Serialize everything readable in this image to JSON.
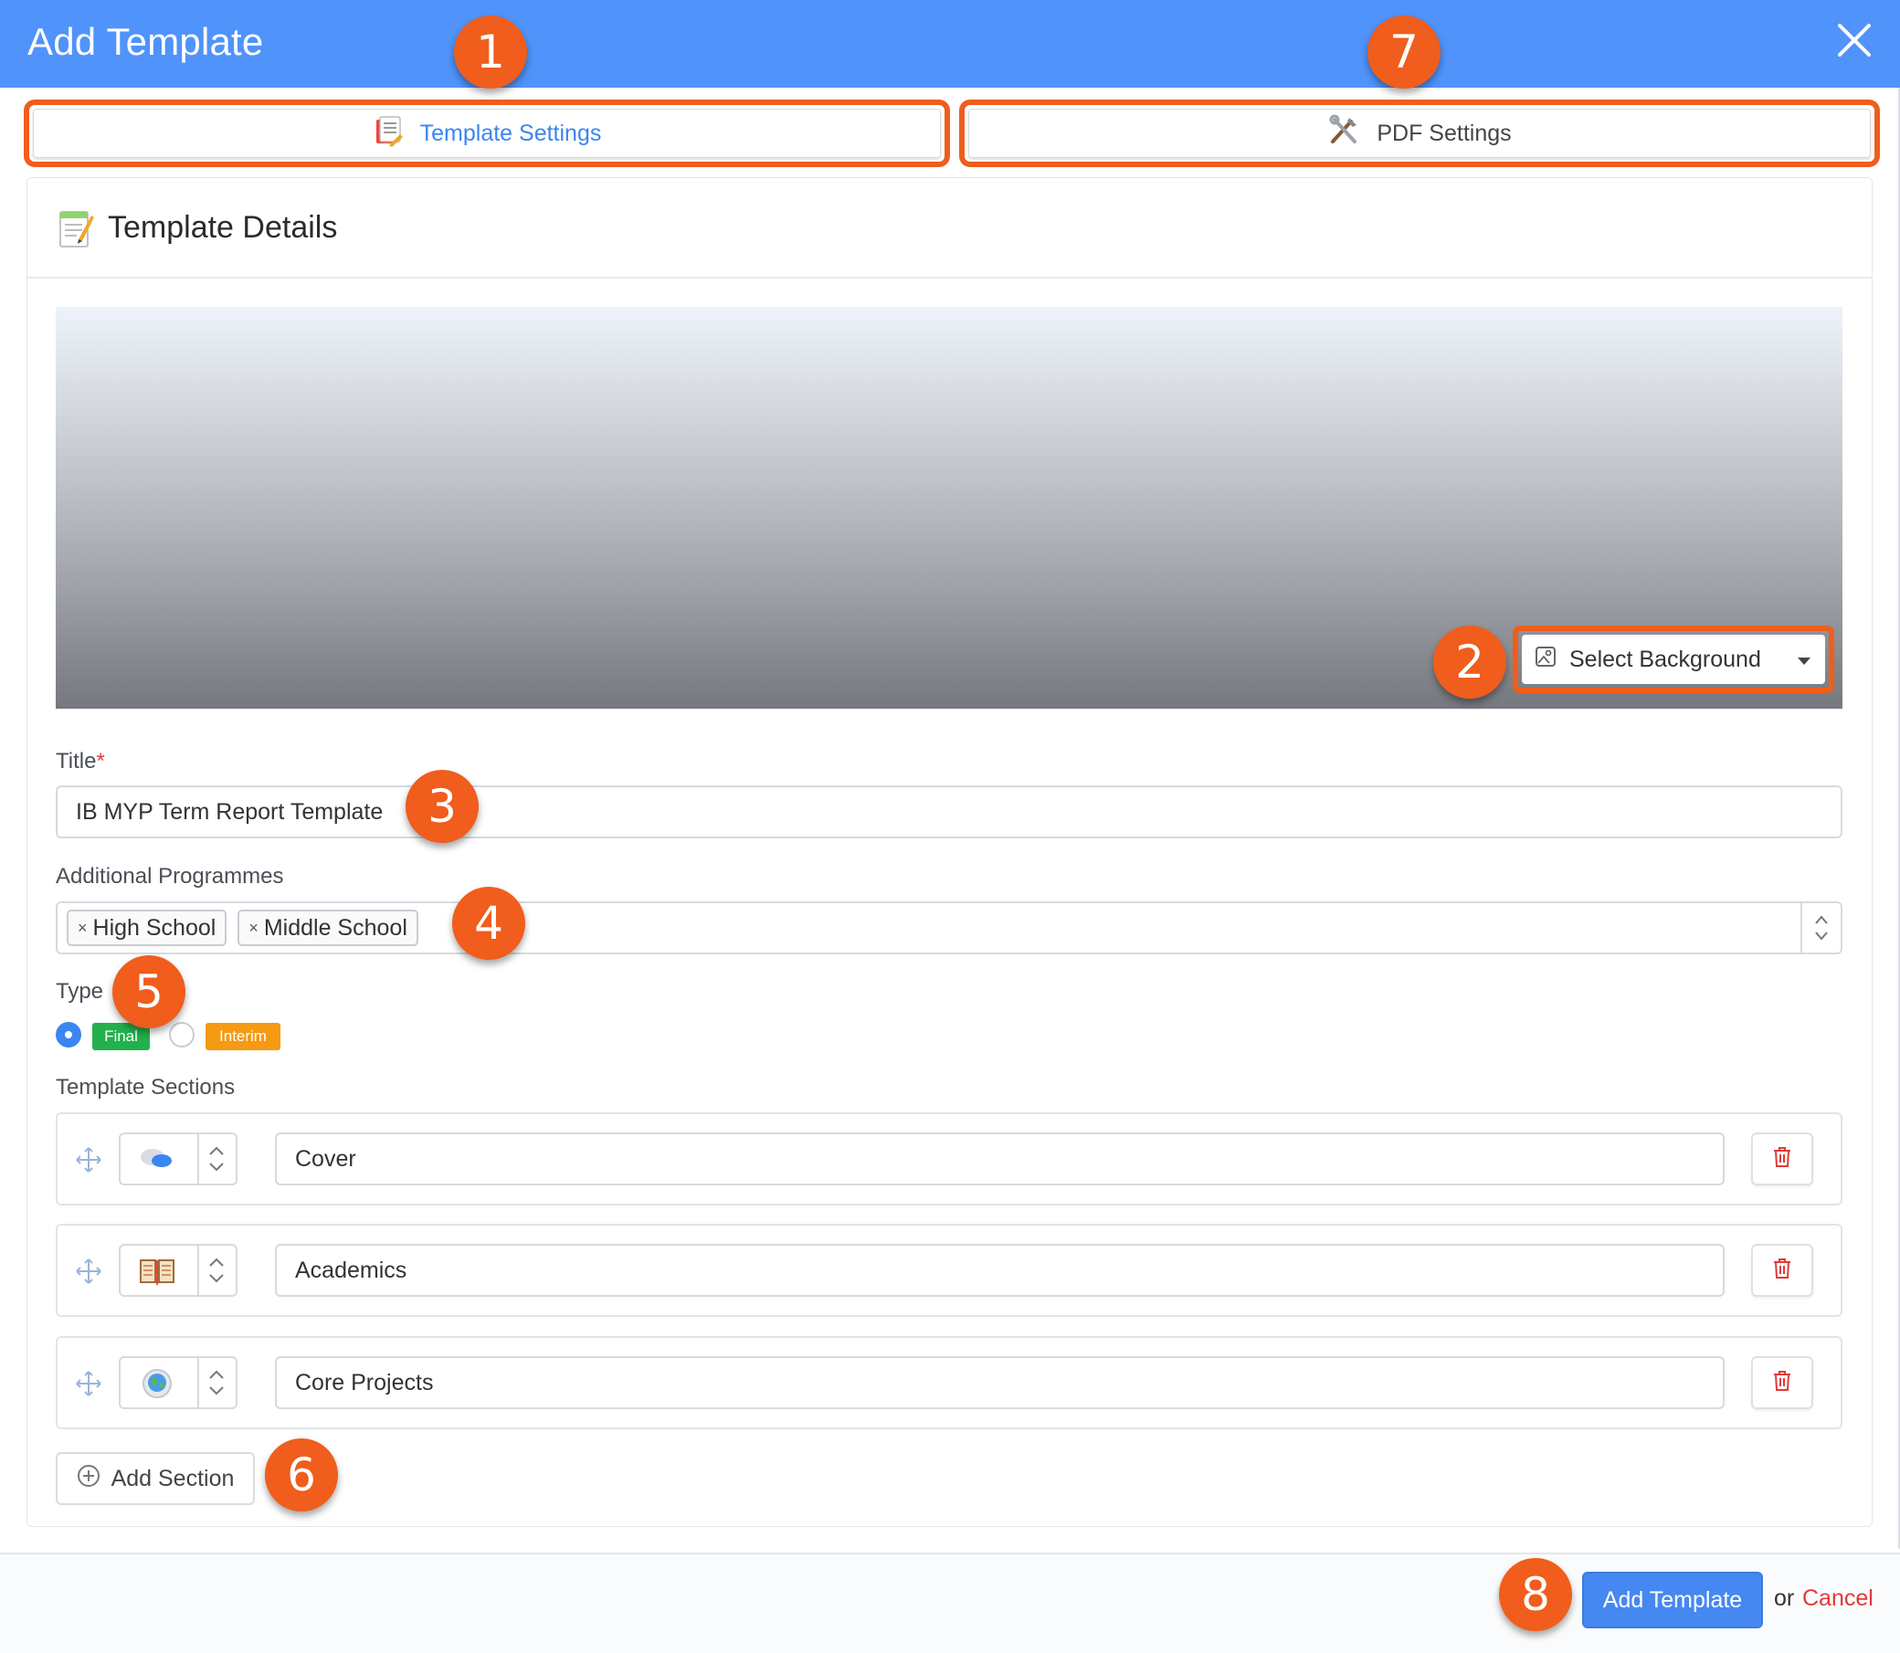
{
  "dialog": {
    "title": "Add Template"
  },
  "tabs": [
    {
      "label": "Template Settings",
      "icon": "template-settings-icon",
      "active": true
    },
    {
      "label": "PDF Settings",
      "icon": "tools-icon",
      "active": false
    }
  ],
  "panel": {
    "title": "Template Details",
    "icon": "memo-icon"
  },
  "banner": {
    "select_background_label": "Select Background"
  },
  "form": {
    "title_label": "Title",
    "title_required_mark": "*",
    "title_value": "IB MYP Term Report Template",
    "programmes_label": "Additional Programmes",
    "programmes": [
      "High School",
      "Middle School"
    ],
    "chip_remove": "×",
    "type_label": "Type",
    "types": [
      {
        "label": "Final",
        "selected": true,
        "color": "#22b14c"
      },
      {
        "label": "Interim",
        "selected": false,
        "color": "#f59a12"
      }
    ],
    "sections_label": "Template Sections",
    "sections": [
      {
        "name": "Cover",
        "icon": "speech-bubbles-icon"
      },
      {
        "name": "Academics",
        "icon": "open-book-icon"
      },
      {
        "name": "Core Projects",
        "icon": "globe-icon"
      }
    ],
    "add_section_label": "Add Section"
  },
  "footer": {
    "submit_label": "Add Template",
    "or_text": "or",
    "cancel_label": "Cancel"
  },
  "callouts": [
    "1",
    "2",
    "3",
    "4",
    "5",
    "6",
    "7",
    "8"
  ],
  "colors": {
    "header": "#4f93fb",
    "callout": "#f05d1c",
    "primary_button": "#4688f1",
    "cancel": "#e03a3a"
  }
}
